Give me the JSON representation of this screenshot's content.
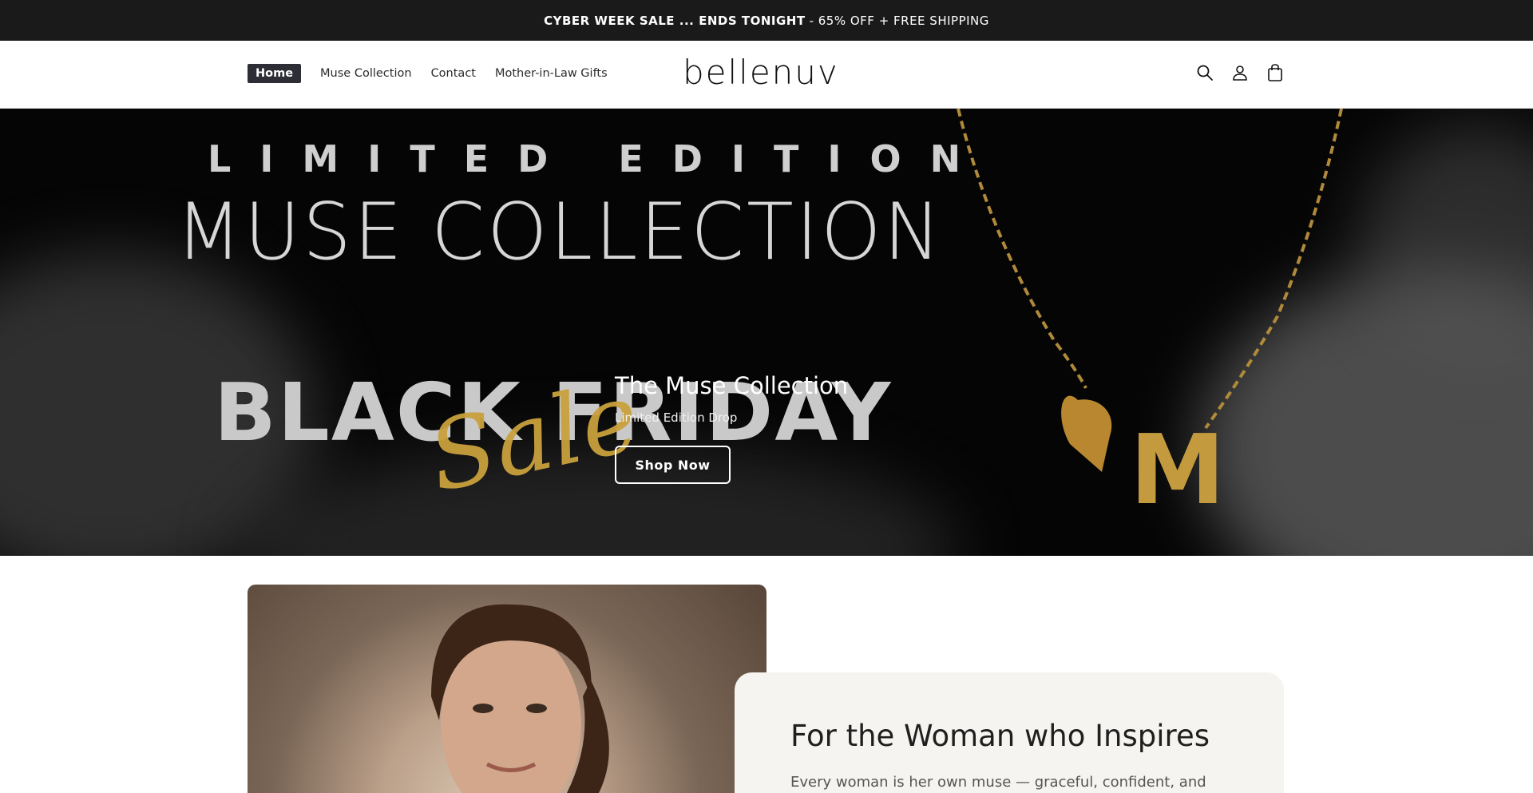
{
  "announcement": {
    "bold": "CYBER WEEK SALE ... ENDS TONIGHT",
    "rest": "- 65% OFF + FREE SHIPPING"
  },
  "header": {
    "logo": "bellenuv",
    "nav": [
      {
        "label": "Home",
        "active": true
      },
      {
        "label": "Muse Collection",
        "active": false
      },
      {
        "label": "Contact",
        "active": false
      },
      {
        "label": "Mother-in-Law Gifts",
        "active": false
      }
    ],
    "icons": [
      "search-icon",
      "account-icon",
      "cart-icon"
    ]
  },
  "hero": {
    "image_text": {
      "limited": "LIMITED EDITION",
      "collection": "MUSE COLLECTION",
      "black_friday": "BLACK FRIDAY",
      "sale": "Sale",
      "pendant_letter": "M"
    },
    "title": "The Muse Collection",
    "subtitle": "Limited Edition Drop",
    "button": "Shop Now",
    "accent_gold": "#c9a13c"
  },
  "feature": {
    "title": "For the Woman who Inspires",
    "body": "Every woman is her own muse — graceful, confident, and"
  }
}
